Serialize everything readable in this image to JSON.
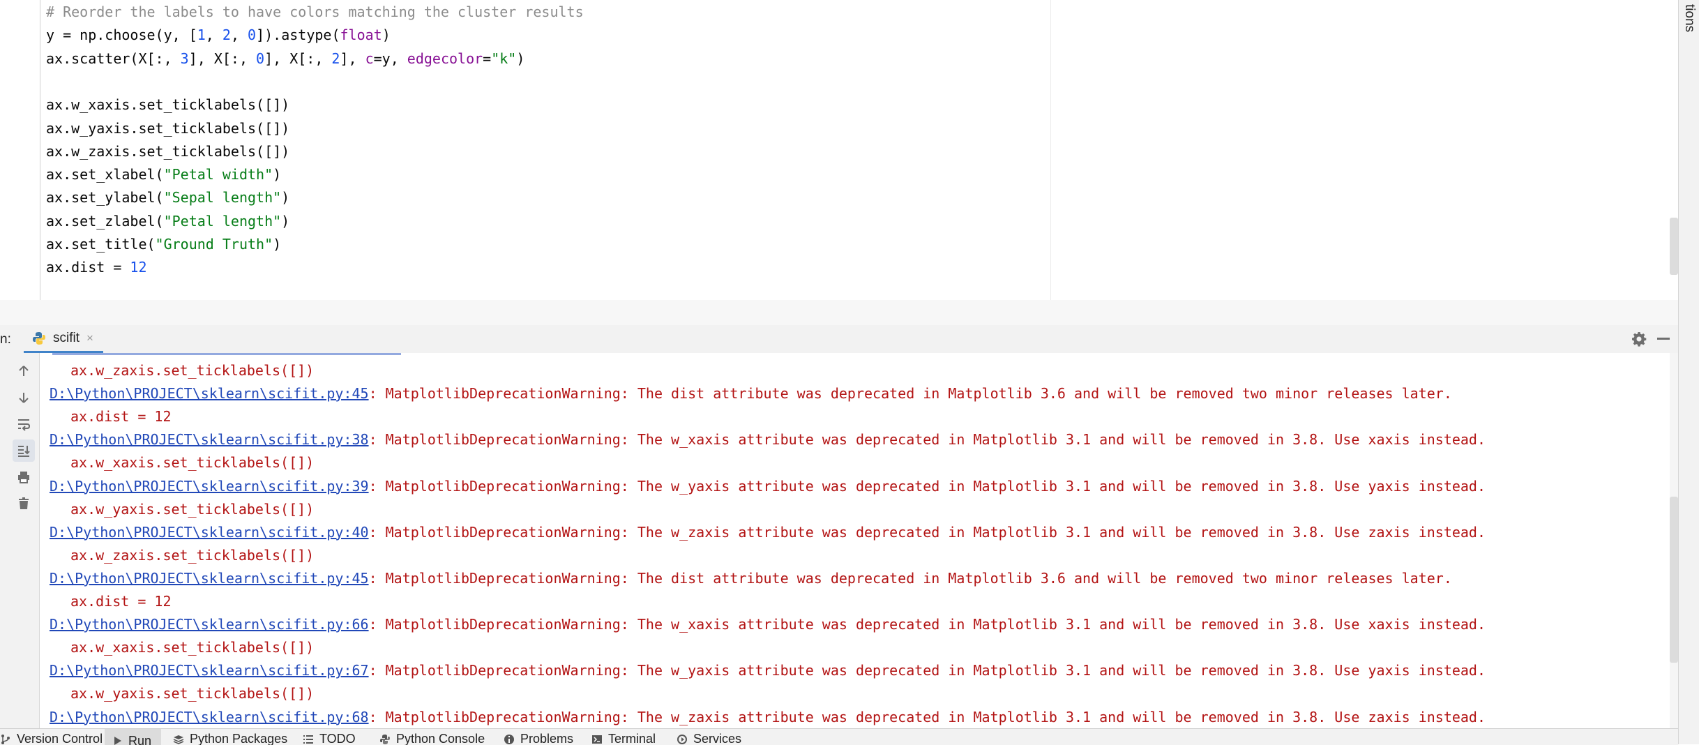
{
  "editor": {
    "lines": [
      [
        {
          "t": "# Reorder the labels to have colors matching the cluster results",
          "c": "comment"
        }
      ],
      [
        {
          "t": "y = np.choose(y, ["
        },
        {
          "t": "1",
          "c": "num"
        },
        {
          "t": ", "
        },
        {
          "t": "2",
          "c": "num"
        },
        {
          "t": ", "
        },
        {
          "t": "0",
          "c": "num"
        },
        {
          "t": "]).astype("
        },
        {
          "t": "float",
          "c": "kw"
        },
        {
          "t": ")"
        }
      ],
      [
        {
          "t": "ax.scatter(X[:, "
        },
        {
          "t": "3",
          "c": "num"
        },
        {
          "t": "], X[:, "
        },
        {
          "t": "0",
          "c": "num"
        },
        {
          "t": "], X[:, "
        },
        {
          "t": "2",
          "c": "num"
        },
        {
          "t": "], "
        },
        {
          "t": "c",
          "c": "kw"
        },
        {
          "t": "=y, "
        },
        {
          "t": "edgecolor",
          "c": "kw"
        },
        {
          "t": "="
        },
        {
          "t": "\"k\"",
          "c": "str"
        },
        {
          "t": ")"
        }
      ],
      [
        {
          "t": ""
        }
      ],
      [
        {
          "t": "ax.w_xaxis.set_ticklabels([])"
        }
      ],
      [
        {
          "t": "ax.w_yaxis.set_ticklabels([])"
        }
      ],
      [
        {
          "t": "ax.w_zaxis.set_ticklabels([])"
        }
      ],
      [
        {
          "t": "ax.set_xlabel("
        },
        {
          "t": "\"Petal width\"",
          "c": "str"
        },
        {
          "t": ")"
        }
      ],
      [
        {
          "t": "ax.set_ylabel("
        },
        {
          "t": "\"Sepal length\"",
          "c": "str"
        },
        {
          "t": ")"
        }
      ],
      [
        {
          "t": "ax.set_zlabel("
        },
        {
          "t": "\"Petal length\"",
          "c": "str"
        },
        {
          "t": ")"
        }
      ],
      [
        {
          "t": "ax.set_title("
        },
        {
          "t": "\"Ground Truth\"",
          "c": "str"
        },
        {
          "t": ")"
        }
      ],
      [
        {
          "t": "ax.dist = "
        },
        {
          "t": "12",
          "c": "num"
        }
      ]
    ]
  },
  "right_strip": {
    "label": "tions"
  },
  "run_panel": {
    "prefix": "n:",
    "tab_label": "scifit",
    "tab_close": "×"
  },
  "console": {
    "lines": [
      {
        "indent": true,
        "text": "ax.w_zaxis.set_ticklabels([])"
      },
      {
        "link": "D:\\Python\\PROJECT\\sklearn\\scifit.py:45",
        "text": ": MatplotlibDeprecationWarning: The dist attribute was deprecated in Matplotlib 3.6 and will be removed two minor releases later."
      },
      {
        "indent": true,
        "text": "ax.dist = 12"
      },
      {
        "link": "D:\\Python\\PROJECT\\sklearn\\scifit.py:38",
        "text": ": MatplotlibDeprecationWarning: The w_xaxis attribute was deprecated in Matplotlib 3.1 and will be removed in 3.8. Use xaxis instead."
      },
      {
        "indent": true,
        "text": "ax.w_xaxis.set_ticklabels([])"
      },
      {
        "link": "D:\\Python\\PROJECT\\sklearn\\scifit.py:39",
        "text": ": MatplotlibDeprecationWarning: The w_yaxis attribute was deprecated in Matplotlib 3.1 and will be removed in 3.8. Use yaxis instead."
      },
      {
        "indent": true,
        "text": "ax.w_yaxis.set_ticklabels([])"
      },
      {
        "link": "D:\\Python\\PROJECT\\sklearn\\scifit.py:40",
        "text": ": MatplotlibDeprecationWarning: The w_zaxis attribute was deprecated in Matplotlib 3.1 and will be removed in 3.8. Use zaxis instead."
      },
      {
        "indent": true,
        "text": "ax.w_zaxis.set_ticklabels([])"
      },
      {
        "link": "D:\\Python\\PROJECT\\sklearn\\scifit.py:45",
        "text": ": MatplotlibDeprecationWarning: The dist attribute was deprecated in Matplotlib 3.6 and will be removed two minor releases later."
      },
      {
        "indent": true,
        "text": "ax.dist = 12"
      },
      {
        "link": "D:\\Python\\PROJECT\\sklearn\\scifit.py:66",
        "text": ": MatplotlibDeprecationWarning: The w_xaxis attribute was deprecated in Matplotlib 3.1 and will be removed in 3.8. Use xaxis instead."
      },
      {
        "indent": true,
        "text": "ax.w_xaxis.set_ticklabels([])"
      },
      {
        "link": "D:\\Python\\PROJECT\\sklearn\\scifit.py:67",
        "text": ": MatplotlibDeprecationWarning: The w_yaxis attribute was deprecated in Matplotlib 3.1 and will be removed in 3.8. Use yaxis instead."
      },
      {
        "indent": true,
        "text": "ax.w_yaxis.set_ticklabels([])"
      },
      {
        "link": "D:\\Python\\PROJECT\\sklearn\\scifit.py:68",
        "text": ": MatplotlibDeprecationWarning: The w_zaxis attribute was deprecated in Matplotlib 3.1 and will be removed in 3.8. Use zaxis instead."
      }
    ]
  },
  "console_toolbar": {
    "icons": [
      "arrow-up-icon",
      "arrow-down-icon",
      "soft-wrap-icon",
      "scroll-to-end-icon",
      "print-icon",
      "trash-icon"
    ]
  },
  "bottom_bar": {
    "items": [
      {
        "name": "version-control",
        "label": "Version Control",
        "icon": "branch-icon"
      },
      {
        "name": "run",
        "label": "Run",
        "icon": "play-icon",
        "active": true
      },
      {
        "name": "python-packages",
        "label": "Python Packages",
        "icon": "layers-icon"
      },
      {
        "name": "todo",
        "label": "TODO",
        "icon": "list-icon"
      },
      {
        "name": "python-console",
        "label": "Python Console",
        "icon": "python-icon"
      },
      {
        "name": "problems",
        "label": "Problems",
        "icon": "info-icon"
      },
      {
        "name": "terminal",
        "label": "Terminal",
        "icon": "terminal-icon"
      },
      {
        "name": "services",
        "label": "Services",
        "icon": "services-icon"
      }
    ]
  },
  "colors": {
    "accent": "#4083c9",
    "link": "#2148b8",
    "warning_text": "#b31414",
    "string": "#067d17",
    "number": "#1750eb",
    "keyword": "#871094",
    "comment": "#8c8c8c"
  }
}
